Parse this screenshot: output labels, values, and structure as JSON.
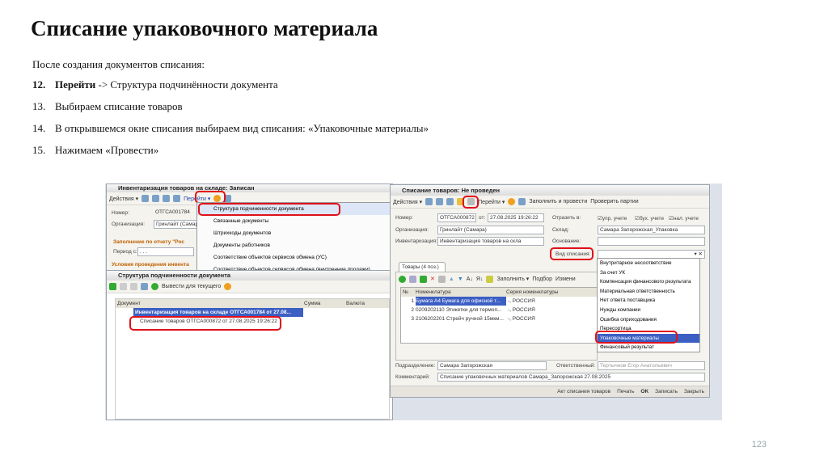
{
  "slide": {
    "title": "Списание упаковочного материала",
    "intro": "После создания документов списания:",
    "steps": [
      {
        "n": "12.",
        "bold": "Перейти",
        "text": " -> Структура подчинённости документа"
      },
      {
        "n": "13.",
        "bold": "",
        "text": "Выбираем списание товаров"
      },
      {
        "n": "14.",
        "bold": "",
        "text": "В открывшемся окне списания выбираем вид списания: «Упаковочные материалы»"
      },
      {
        "n": "15.",
        "bold": "",
        "text": "Нажимаем «Провести»"
      }
    ],
    "page_number": "123"
  },
  "inv": {
    "title": "Инвентаризация товаров на складе: Записан",
    "actions": "Действия ▾",
    "goto": "Перейти ▾",
    "number_label": "Номер:",
    "number": "ОТГСА001784",
    "org_label": "Организация:",
    "org": "Гринлайт (Самар",
    "fill_section": "Заполнение по отчету \"Рос",
    "period_label": "Период с:",
    "period": ". . .",
    "conditions": "Условия проведения инвента"
  },
  "goto_menu": [
    "Структура подчиненности документа",
    "Связанные документы",
    "Штрихкоды документов",
    "Документы работников",
    "Соответствие объектов сервисов обмена (УС)",
    "Соответствие объектов сервисов обмена (внутренние продажи)"
  ],
  "struct": {
    "title": "Структура подчиненности документа",
    "output_btn": "Вывести для текущего",
    "cols": [
      "Документ",
      "Сумма",
      "Валюта"
    ],
    "rows": [
      "Инвентаризация товаров на складе ОТГСА001784 от 27.08...",
      "Списание товаров ОТГСА000872 от 27.08.2025 19:26:22"
    ]
  },
  "wo": {
    "title": "Списание товаров: Не проведен",
    "actions": "Действия ▾",
    "goto": "Перейти ▾",
    "fill_post": "Заполнить и провести",
    "check": "Проверить партии",
    "number_label": "Номер:",
    "number": "ОТГСА000872",
    "from": "от:",
    "date": "27.08.2025 19:26:22",
    "reflect_label": "Отразить в:",
    "chk": [
      "упр. учете",
      "бух. учете",
      "нал. учете"
    ],
    "org_label": "Организация:",
    "org": "Гринлайт (Самара)",
    "wh_label": "Склад:",
    "wh": "Самара Запорожская_Упаковка",
    "inv_label": "Инвентаризация:",
    "inv": "Инвентаризация товаров на скла",
    "basis_label": "Основание:",
    "type_label": "Вид списания:",
    "tab": "Товары (4 поз.)",
    "fill": "Заполнить ▾",
    "pick": "Подбор",
    "change": "Измени",
    "cols": [
      "№",
      "Номенклатура",
      "Серия номенклатуры"
    ],
    "rows": [
      [
        "1",
        "Бумага А4 Бумага для офисной т...",
        "-, РОССИЯ"
      ],
      [
        "2",
        "0209202110 Этикетки для термоп...",
        "-, РОССИЯ"
      ],
      [
        "3",
        "2106202201 Стрейч ручной 15мкм...",
        "-, РОССИЯ"
      ]
    ],
    "dept_label": "Подразделение:",
    "dept": "Самара Запорожская",
    "resp_label": "Ответственный:",
    "resp": "Тертычнов Егор Анатольевич",
    "comment_label": "Комментарий:",
    "comment": "Списание упаковочных материалов Самара_Запорожская 27.08.2025",
    "footer": [
      "Акт списания товаров",
      "Печать",
      "OK",
      "Записать",
      "Закрыть"
    ]
  },
  "types": [
    "Внутритарное несоответствие",
    "За счет УК",
    "Компенсация финансового результата",
    "Материальная ответственность",
    "Нет ответа поставщика",
    "Нужды компании",
    "Ошибка оприходования",
    "Пересортица",
    "Упаковочные материалы",
    "Финансовый результат"
  ]
}
